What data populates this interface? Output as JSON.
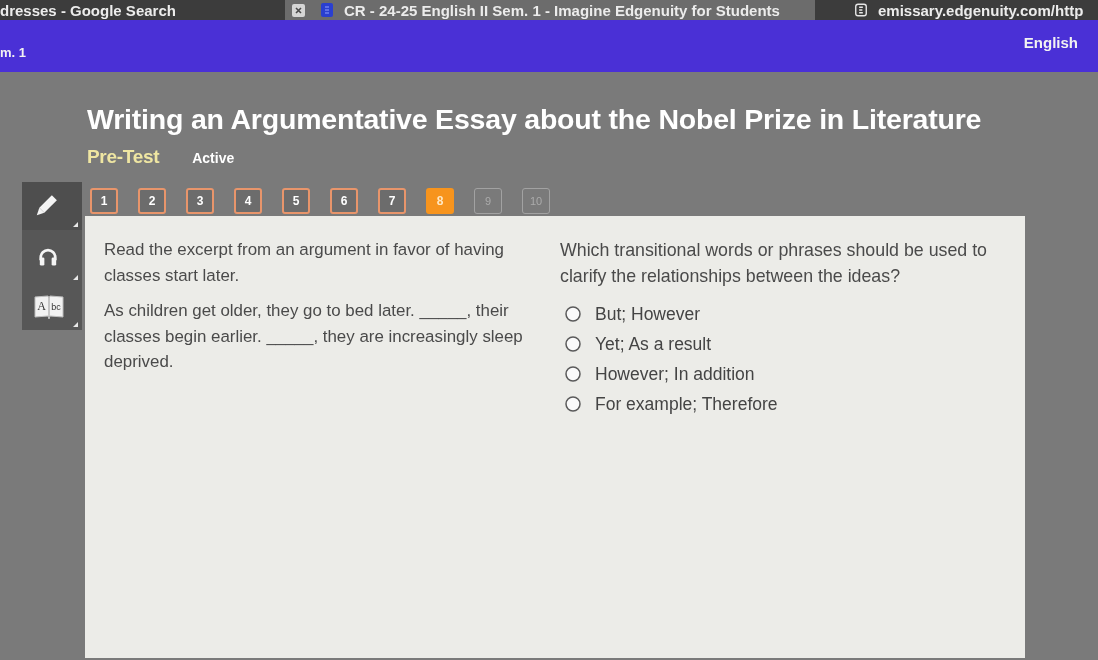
{
  "browser": {
    "tabs": [
      {
        "title": "dresses - Google Search",
        "selected": false
      },
      {
        "title": "CR - 24-25 English II Sem. 1 - Imagine Edgenuity for Students",
        "selected": true
      },
      {
        "title": "emissary.edgenuity.com/http",
        "selected": false
      }
    ]
  },
  "course_bar": {
    "course": "m. 1",
    "subject": "English"
  },
  "activity": {
    "title": "Writing an Argumentative Essay about the Nobel Prize in Literature",
    "type": "Pre-Test",
    "status": "Active"
  },
  "tools": {
    "book_letters": [
      "A",
      "bc"
    ]
  },
  "question_nav": [
    {
      "label": "1",
      "selected": false,
      "answered": true
    },
    {
      "label": "2",
      "selected": false,
      "answered": true
    },
    {
      "label": "3",
      "selected": false,
      "answered": true
    },
    {
      "label": "4",
      "selected": false,
      "answered": true
    },
    {
      "label": "5",
      "selected": false,
      "answered": true
    },
    {
      "label": "6",
      "selected": false,
      "answered": true
    },
    {
      "label": "7",
      "selected": false,
      "answered": true
    },
    {
      "label": "8",
      "selected": true,
      "answered": false
    },
    {
      "label": "9",
      "selected": false,
      "answered": false
    },
    {
      "label": "10",
      "selected": false,
      "answered": false
    }
  ],
  "question": {
    "prompt": "Read the excerpt from an argument in favor of having classes start later.",
    "excerpt": "As children get older, they go to bed later. _____, their classes begin earlier. _____, they are increasingly sleep deprived.",
    "stem": "Which transitional words or phrases should be used to clarify the relationships between the ideas?",
    "options": [
      {
        "label": "But; However",
        "selected": false
      },
      {
        "label": "Yet; As a result",
        "selected": false
      },
      {
        "label": "However; In addition",
        "selected": false
      },
      {
        "label": "For example; Therefore",
        "selected": false
      }
    ]
  }
}
